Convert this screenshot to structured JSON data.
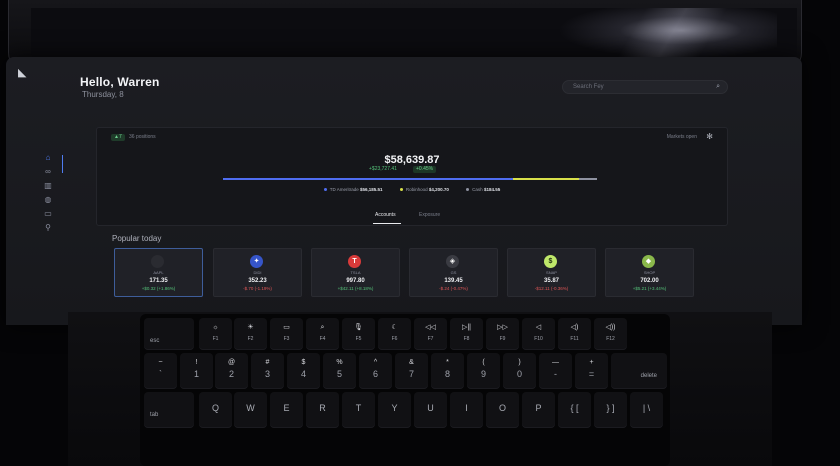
{
  "app": {
    "greeting": "Hello, Warren",
    "date": "Thursday, 8",
    "search_placeholder": "Search Fey",
    "sidebar_icons": [
      "home-icon",
      "link-icon",
      "chart-icon",
      "globe-icon",
      "wallet-icon",
      "user-icon"
    ]
  },
  "portfolio": {
    "badge": "▲7",
    "positions": "36 positions",
    "market_status": "Markets open",
    "total": "$58,639.87",
    "change": "+$23,727.41",
    "change_pct": "+0.45%",
    "brokers": [
      {
        "name": "TD Ameritrade",
        "value": "$56,185.51",
        "color": "#4f6df0"
      },
      {
        "name": "Robinhood",
        "value": "$4,200.70",
        "color": "#d8e04a"
      },
      {
        "name": "Cash",
        "value": "$184.55",
        "color": "#8e92a0"
      }
    ],
    "tabs": [
      "Accounts",
      "Exposure"
    ]
  },
  "popular": {
    "title": "Popular today",
    "stocks": [
      {
        "ticker": "AAPL",
        "price": "171.35",
        "change": "+$0.32 (+1.86%)",
        "direction": "up",
        "logo": "",
        "color": "#ffffff",
        "bg": "#2a2b31"
      },
      {
        "ticker": "DIDI",
        "price": "352.23",
        "change": "-$.70 (-1.19%)",
        "direction": "down",
        "logo": "✦",
        "color": "#ffffff",
        "bg": "#3655c9"
      },
      {
        "ticker": "TSLA",
        "price": "997.80",
        "change": "+$42.11 (+8.18%)",
        "direction": "up",
        "logo": "T",
        "color": "#ffffff",
        "bg": "#d83a3a"
      },
      {
        "ticker": "GS",
        "price": "139.45",
        "change": "-$.24 (-0.47%)",
        "direction": "down",
        "logo": "◈",
        "color": "#ffffff",
        "bg": "#3a3b42"
      },
      {
        "ticker": "SNAP",
        "price": "35.87",
        "change": "-$12.11 (-0.36%)",
        "direction": "down",
        "logo": "$",
        "color": "#1c2a10",
        "bg": "#bfe86a"
      },
      {
        "ticker": "SHOP",
        "price": "702.00",
        "change": "+$5.21 (+3.44%)",
        "direction": "up",
        "logo": "◆",
        "color": "#ffffff",
        "bg": "#8ab84b"
      }
    ]
  },
  "keyboard": {
    "fn_row": [
      {
        "icon": "",
        "label": "esc"
      },
      {
        "icon": "☼",
        "label": "F1"
      },
      {
        "icon": "☀",
        "label": "F2"
      },
      {
        "icon": "▭",
        "label": "F3"
      },
      {
        "icon": "⌕",
        "label": "F4"
      },
      {
        "icon": "🎙",
        "label": "F5"
      },
      {
        "icon": "☾",
        "label": "F6"
      },
      {
        "icon": "◁◁",
        "label": "F7"
      },
      {
        "icon": "▷||",
        "label": "F8"
      },
      {
        "icon": "▷▷",
        "label": "F9"
      },
      {
        "icon": "◁",
        "label": "F10"
      },
      {
        "icon": "◁)",
        "label": "F11"
      },
      {
        "icon": "◁))",
        "label": "F12"
      }
    ],
    "num_row": [
      {
        "top": "~",
        "bot": "`"
      },
      {
        "top": "!",
        "bot": "1"
      },
      {
        "top": "@",
        "bot": "2"
      },
      {
        "top": "#",
        "bot": "3"
      },
      {
        "top": "$",
        "bot": "4"
      },
      {
        "top": "%",
        "bot": "5"
      },
      {
        "top": "^",
        "bot": "6"
      },
      {
        "top": "&",
        "bot": "7"
      },
      {
        "top": "*",
        "bot": "8"
      },
      {
        "top": "(",
        "bot": "9"
      },
      {
        "top": ")",
        "bot": "0"
      },
      {
        "top": "—",
        "bot": "-"
      },
      {
        "top": "+",
        "bot": "="
      },
      {
        "top": "",
        "bot": "delete"
      }
    ],
    "letter_row": [
      "tab",
      "Q",
      "W",
      "E",
      "R",
      "T",
      "Y",
      "U",
      "I",
      "O",
      "P",
      "{ [",
      "} ]",
      "| \\"
    ]
  }
}
